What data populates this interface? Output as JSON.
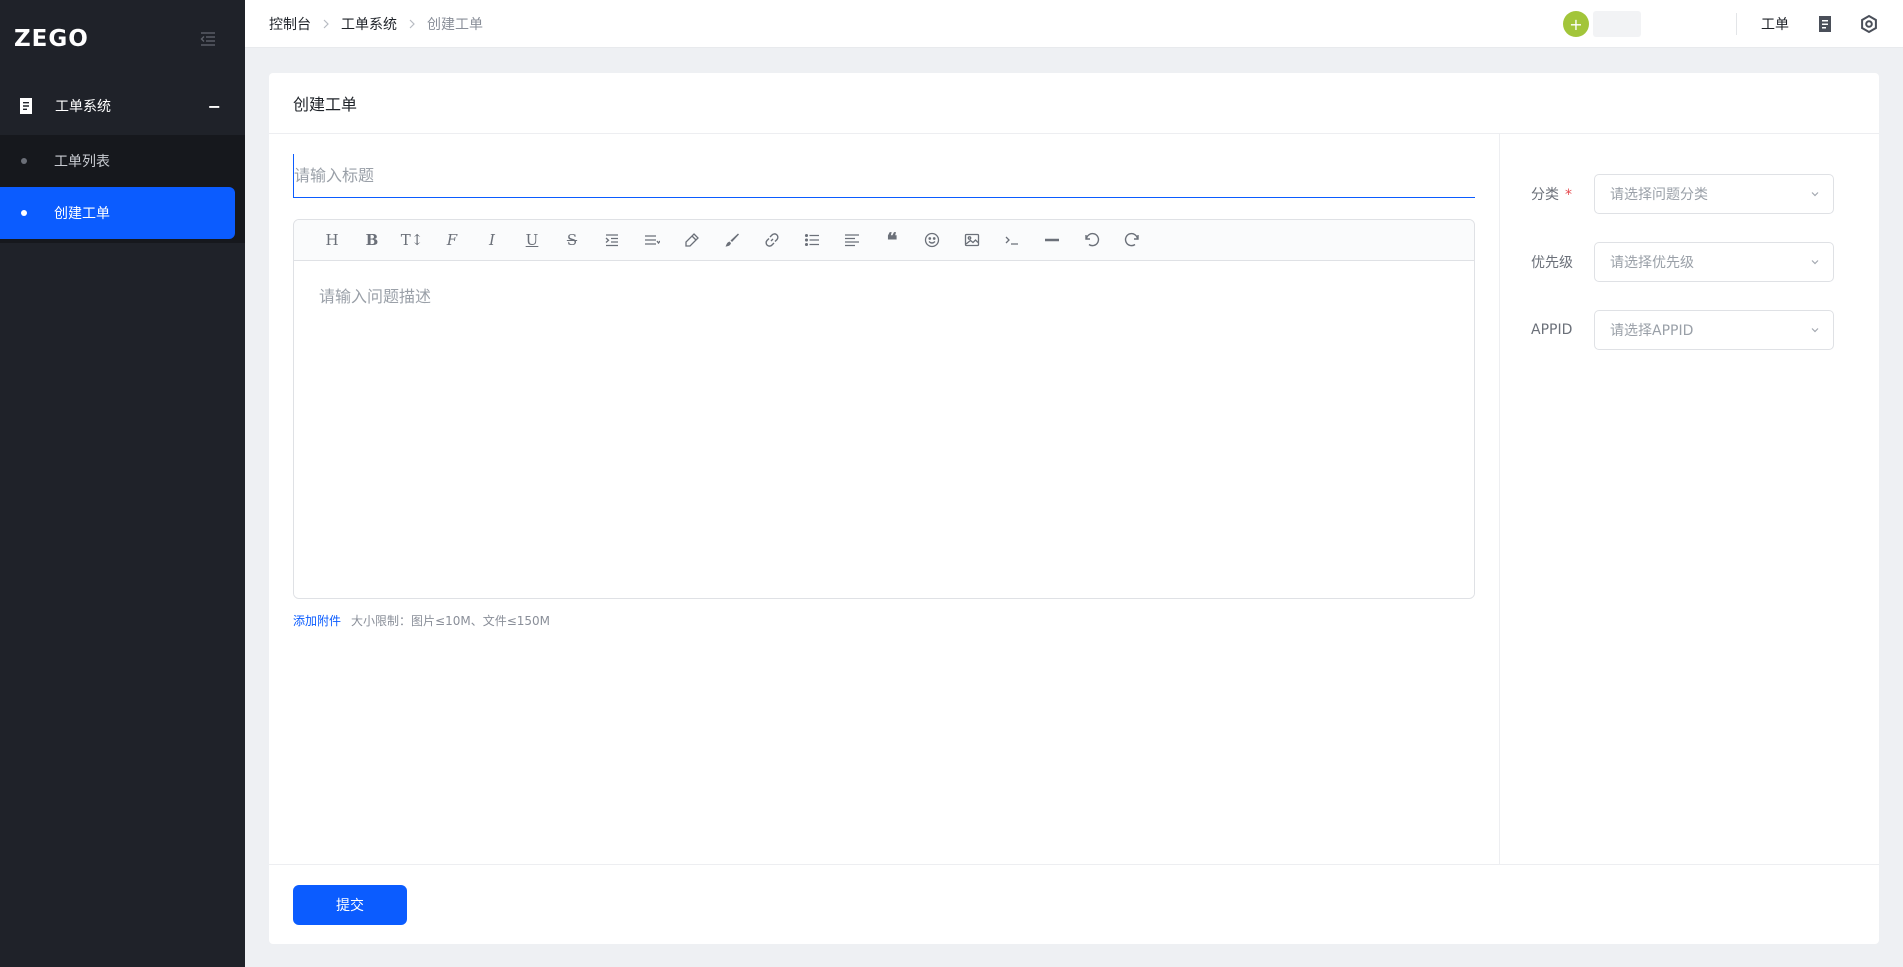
{
  "sidebar": {
    "logo": "ZEGO",
    "group_label": "工单系统",
    "group_toggle": "−",
    "items": [
      {
        "label": "工单列表"
      },
      {
        "label": "创建工单"
      }
    ]
  },
  "topbar": {
    "breadcrumb": [
      "控制台",
      "工单系统",
      "创建工单"
    ],
    "avatar_glyph": "+",
    "ticket_link": "工单"
  },
  "card": {
    "title": "创建工单",
    "title_placeholder": "请输入标题",
    "editor_placeholder": "请输入问题描述",
    "toolbar": [
      "heading-icon",
      "bold-icon",
      "font-size-icon",
      "font-color-icon",
      "italic-icon",
      "underline-icon",
      "strikethrough-icon",
      "indent-icon",
      "line-height-icon",
      "background-color-icon",
      "brush-icon",
      "link-icon",
      "list-icon",
      "align-icon",
      "quote-icon",
      "emoji-icon",
      "image-icon",
      "code-icon",
      "divider-icon",
      "undo-icon",
      "redo-icon"
    ],
    "attach_link": "添加附件",
    "attach_hint": "大小限制：图片≤10M、文件≤150M"
  },
  "form": {
    "category_label": "分类",
    "category_required": "*",
    "category_placeholder": "请选择问题分类",
    "priority_label": "优先级",
    "priority_placeholder": "请选择优先级",
    "appid_label": "APPID",
    "appid_placeholder": "请选择APPID"
  },
  "footer": {
    "submit_label": "提交"
  },
  "colors": {
    "primary": "#0b5cff",
    "sidebar_bg": "#1f2229",
    "avatar": "#a2c53a"
  }
}
